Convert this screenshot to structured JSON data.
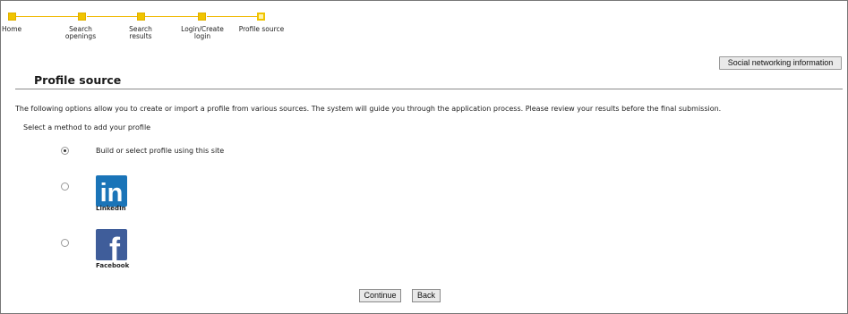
{
  "progress": {
    "steps": [
      {
        "label_line1": "Home",
        "label_line2": ""
      },
      {
        "label_line1": "Search",
        "label_line2": "openings"
      },
      {
        "label_line1": "Search",
        "label_line2": "results"
      },
      {
        "label_line1": "Login/Create",
        "label_line2": "login"
      },
      {
        "label_line1": "Profile source",
        "label_line2": ""
      }
    ],
    "current_step": 5,
    "colors": {
      "complete": "#f0c400",
      "current_fill": "#fff2a8"
    }
  },
  "toolbar": {
    "social_networking_label": "Social networking information"
  },
  "page": {
    "title": "Profile source",
    "intro": "The following options allow you to create or import a profile from various sources. The system will guide you through the application process. Please review your results before the final submission.",
    "method_prompt": "Select a method to add your profile"
  },
  "options": {
    "site": {
      "label": "Build or select profile using this site",
      "selected": true
    },
    "linkedin": {
      "logo_text": "in",
      "caption": "LinkedIn",
      "selected": false,
      "color": "#1a74b8"
    },
    "facebook": {
      "logo_text": "f",
      "caption": "Facebook",
      "selected": false,
      "color": "#3f5d9a"
    }
  },
  "actions": {
    "continue_label": "Continue",
    "back_label": "Back"
  }
}
